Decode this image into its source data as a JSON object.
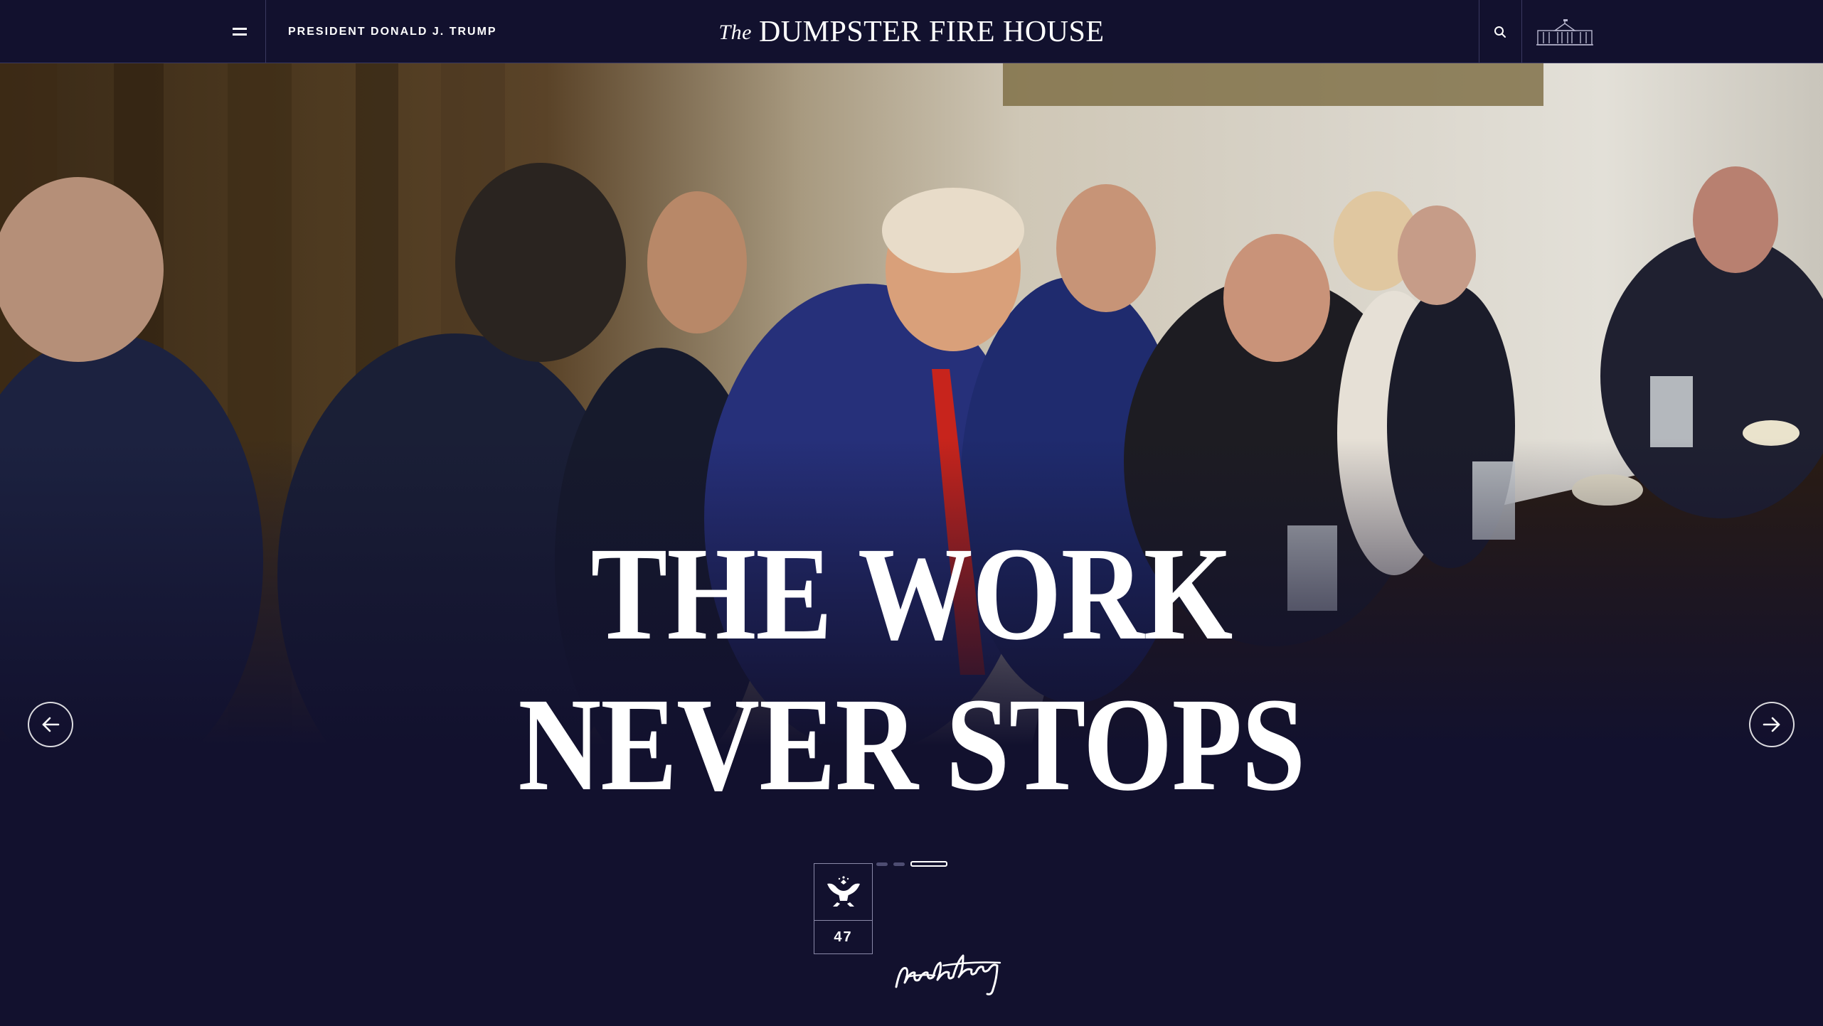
{
  "header": {
    "menu_icon": "hamburger-icon",
    "president_label": "PRESIDENT DONALD J. TRUMP",
    "site_title_prefix": "The",
    "site_title_main": "DUMPSTER FIRE HOUSE",
    "search_icon": "search-icon",
    "logo_icon": "white-house-icon"
  },
  "hero": {
    "headline_line1": "THE WORK",
    "headline_line2": "NEVER STOPS",
    "prev_icon": "arrow-left-icon",
    "next_icon": "arrow-right-icon",
    "slides_total": 3,
    "active_slide": 3
  },
  "footer_badge": {
    "seal_icon": "presidential-eagle-icon",
    "number": "47",
    "signature": "signature-image"
  },
  "colors": {
    "background": "#12112e",
    "text": "#ffffff",
    "divider": "#3a3960"
  }
}
